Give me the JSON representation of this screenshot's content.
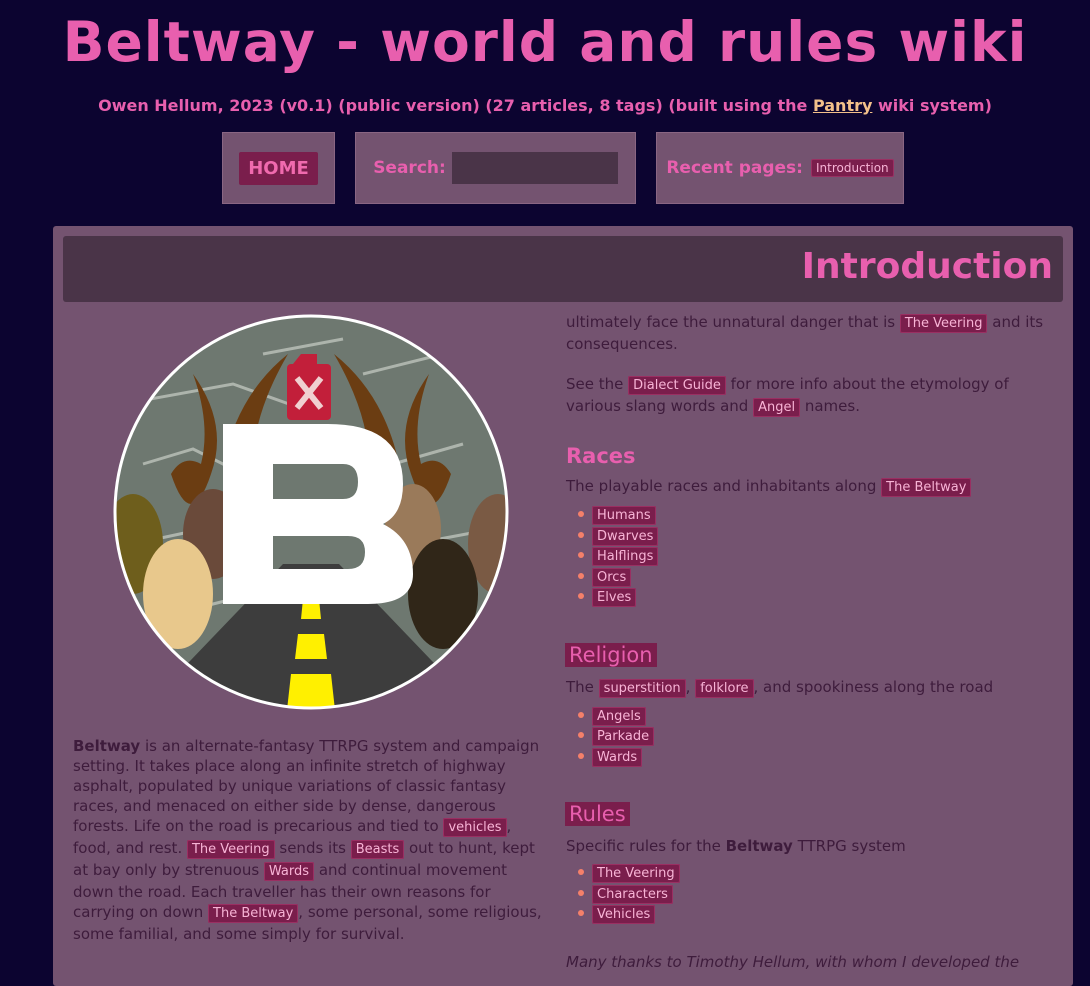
{
  "header": {
    "title": "Beltway - world and rules wiki",
    "subtitle_before": "Owen Hellum, 2023 (v0.1) (public version) (27 articles, 8 tags) (built using the ",
    "subtitle_link": "Pantry",
    "subtitle_after": " wiki system)"
  },
  "nav": {
    "home_label": "HOME",
    "search_label": "Search:",
    "search_value": "",
    "recent_label": "Recent pages:",
    "recent_pages": [
      "Introduction"
    ]
  },
  "page": {
    "title": "Introduction",
    "intro": {
      "strong": "Beltway",
      "t1": " is an alternate-fantasy TTRPG system and campaign setting. It takes place along an infinite stretch of highway asphalt, populated by unique variations of classic fantasy races, and menaced on either side by dense, dangerous forests. Life on the road is precarious and tied to ",
      "tag_vehicles": "vehicles",
      "t2": ", food, and rest. ",
      "tag_veering": "The Veering",
      "t3": " sends its ",
      "tag_beasts": "Beasts",
      "t4": " out to hunt, kept at bay only by strenuous ",
      "tag_wards": "Wards",
      "t5": " and continual movement down the road. Each traveller has their own reasons for carrying on down ",
      "tag_beltway": "The Beltway",
      "t6": ", some personal, some religious, some familial, and some simply for survival."
    },
    "cont": {
      "t1": "ultimately face the unnatural danger that is ",
      "tag_veering": "The Veering",
      "t2": " and its consequences."
    },
    "dialect": {
      "t1": "See the ",
      "tag_guide": "Dialect Guide",
      "t2": " for more info about the etymology of various slang words and ",
      "tag_angel": "Angel",
      "t3": " names."
    },
    "races": {
      "heading": "Races",
      "desc": "The playable races and inhabitants along ",
      "desc_tag": "The Beltway",
      "items": [
        "Humans",
        "Dwarves",
        "Halflings",
        "Orcs",
        "Elves"
      ]
    },
    "religion": {
      "heading": "Religion",
      "desc1": "The ",
      "tag1": "superstition",
      "sep": ", ",
      "tag2": "folklore",
      "desc2": ", and spookiness along the road",
      "items": [
        "Angels",
        "Parkade",
        "Wards"
      ]
    },
    "rules": {
      "heading": "Rules",
      "desc1": "Specific rules for the ",
      "desc_strong": "Beltway",
      "desc2": " TTRPG system",
      "items": [
        "The Veering",
        "Characters",
        "Vehicles"
      ]
    },
    "thanks": "Many thanks to Timothy Hellum, with whom I developed the"
  },
  "colors": {
    "background": "#0c0430",
    "accent": "#e85fae",
    "panel": "#745370",
    "tag_bg": "#7a1e4c",
    "bullet": "#f5806a"
  }
}
